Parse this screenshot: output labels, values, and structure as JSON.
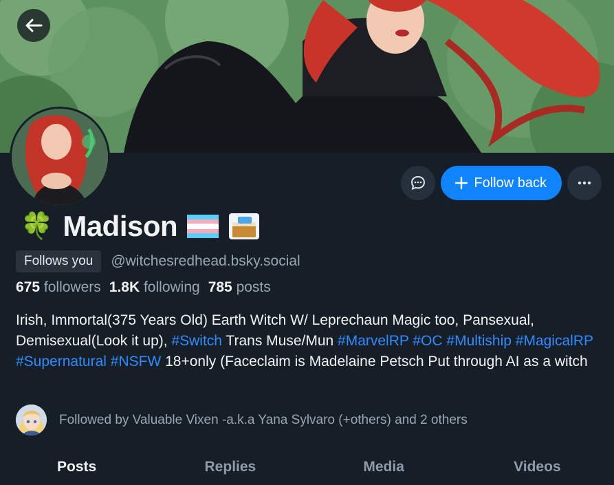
{
  "profile": {
    "name": "Madison",
    "name_prefix_emoji": "🍀",
    "badge": "Follows you",
    "handle": "@witchesredhead.bsky.social",
    "stats": {
      "followers_count": "675",
      "followers_label": "followers",
      "following_count": "1.8K",
      "following_label": "following",
      "posts_count": "785",
      "posts_label": "posts"
    },
    "bio": [
      {
        "t": "Irish, Immortal(375 Years Old) Earth Witch W/ Leprechaun Magic too, Pansexual, Demisexual(Look it up), ",
        "tag": false
      },
      {
        "t": "#Switch",
        "tag": true
      },
      {
        "t": " Trans Muse/Mun ",
        "tag": false
      },
      {
        "t": "#MarvelRP",
        "tag": true
      },
      {
        "t": " ",
        "tag": false
      },
      {
        "t": "#OC",
        "tag": true
      },
      {
        "t": " ",
        "tag": false
      },
      {
        "t": "#Multiship",
        "tag": true
      },
      {
        "t": " ",
        "tag": false
      },
      {
        "t": "#MagicalRP",
        "tag": true
      },
      {
        "t": " ",
        "tag": false
      },
      {
        "t": "#Supernatural",
        "tag": true
      },
      {
        "t": " ",
        "tag": false
      },
      {
        "t": "#NSFW",
        "tag": true
      },
      {
        "t": " 18+only (Faceclaim is Madelaine Petsch Put through AI as a witch",
        "tag": false
      }
    ],
    "followed_by": "Followed by Valuable Vixen -a.k.a Yana Sylvaro (+others) and 2 others"
  },
  "actions": {
    "follow_label": "Follow back",
    "message_icon": "message-icon",
    "more_icon": "more-icon"
  },
  "tabs": [
    {
      "label": "Posts",
      "active": true
    },
    {
      "label": "Replies",
      "active": false
    },
    {
      "label": "Media",
      "active": false
    },
    {
      "label": "Videos",
      "active": false
    }
  ],
  "colors": {
    "accent": "#1083fe",
    "hashtag": "#2f8cff",
    "background": "#161e27"
  }
}
